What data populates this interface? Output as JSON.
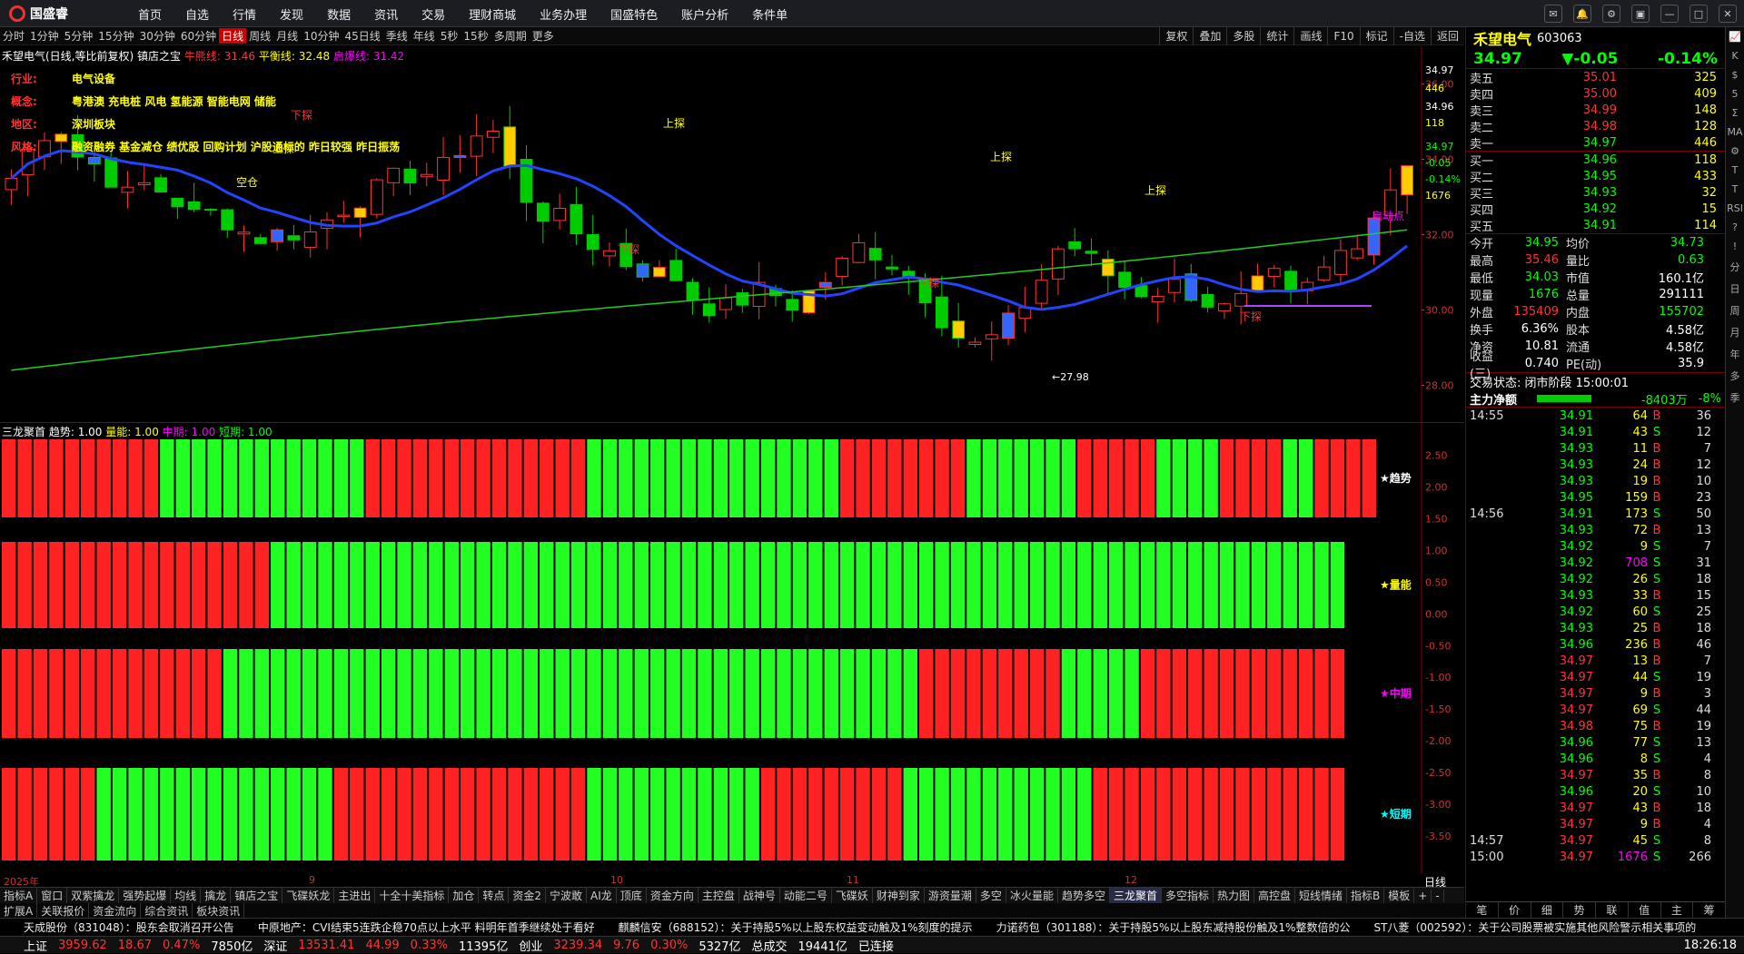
{
  "app": {
    "logo": "国盛睿",
    "menu": [
      "首页",
      "自选",
      "行情",
      "发现",
      "数据",
      "资讯",
      "交易",
      "理财商城",
      "业务办理",
      "国盛特色",
      "账户分析",
      "条件单"
    ]
  },
  "periods": [
    "分时",
    "1分钟",
    "5分钟",
    "15分钟",
    "30分钟",
    "60分钟",
    "日线",
    "周线",
    "月线",
    "10分钟",
    "45日线",
    "季线",
    "年线",
    "5秒",
    "15秒",
    "多周期",
    "更多"
  ],
  "active_period": "日线",
  "rtools": [
    "复权",
    "叠加",
    "多股",
    "统计",
    "画线",
    "F10",
    "标记",
    "-自选",
    "返回"
  ],
  "chart_title": {
    "name": "禾望电气(日线,等比前复权)",
    "tool": "镇店之宝",
    "l1": "牛熊线: 31.46",
    "l2": "平衡线: 32.48",
    "l3": "启爆线: 31.42"
  },
  "info_lines": {
    "industry_k": "行业:",
    "industry_v": "电气设备",
    "concept_k": "概念:",
    "concept_v": "粤港澳 充电桩 风电 氢能源 智能电网 储能",
    "region_k": "地区:",
    "region_v": "深圳板块",
    "style_k": "风格:",
    "style_v": "融资融券 基金减仓 绩优股 回购计划 沪股通标的 昨日较强 昨日振荡"
  },
  "chart_data": {
    "type": "candlestick",
    "ylim": [
      27,
      37
    ],
    "y_ticks": [
      "36.00",
      "34.00",
      "32.00",
      "30.00",
      "28.00"
    ],
    "right_labels": [
      "34.97",
      "446",
      "34.96",
      "118",
      "34.97",
      "-0.05",
      "-0.14%",
      "1676"
    ],
    "x_labels": [
      "2025年",
      "9",
      "10",
      "11",
      "12"
    ],
    "low_label": "←27.98",
    "annotations": [
      "下探",
      "上探",
      "空仓",
      "启动点"
    ]
  },
  "ind": {
    "name": "三龙聚首",
    "l1": "趋势: 1.00",
    "l2": "量能: 1.00",
    "l3": "中期: 1.00",
    "l4": "短期: 1.00",
    "y_ticks": [
      "2.50",
      "2.00",
      "1.50",
      "1.00",
      "0.50",
      "0.00",
      "-0.50",
      "-1.00",
      "-1.50",
      "-2.00",
      "-2.50",
      "-3.00",
      "-3.50"
    ],
    "bands": [
      "★趋势",
      "★量能",
      "★中期",
      "★短期"
    ]
  },
  "tabs": [
    "指标A",
    "窗口",
    "双紫擒龙",
    "强势起爆",
    "均线",
    "擒龙",
    "镇店之宝",
    "飞碟妖龙",
    "主进出",
    "十全十美指标",
    "加仓",
    "转点",
    "资金2",
    "宁波敢",
    "AI龙",
    "顶底",
    "资金方向",
    "主控盘",
    "战神号",
    "动能二号",
    "飞碟妖",
    "财神到家",
    "游资量潮",
    "多空",
    "冰火量能",
    "趋势多空",
    "三龙聚首",
    "多空指标",
    "热力图",
    "高控盘",
    "短线情绪",
    "指标B",
    "模板",
    "+",
    "-"
  ],
  "tabs2": [
    "扩展A",
    "关联报价",
    "资金流向",
    "综合资讯",
    "板块资讯"
  ],
  "ticker": [
    "天成股份（831048）：股东会取消召开公告",
    "中原地产：CVI结束5连跌企稳70点以上水平 料明年首季继续处于看好",
    "麒麟信安（688152）：关于持股5%以上股东权益变动触及1%刻度的提示",
    "力诺药包（301188）：关于持股5%以上股东减持股份触及1%整数倍的公",
    "ST八菱（002592）：关于公司股票被实施其他风险警示相关事项的"
  ],
  "status": {
    "sh_l": "上证",
    "sh": "3959.62",
    "sh_c": "18.67",
    "sh_p": "0.47%",
    "sh_v": "7850亿",
    "sz_l": "深证",
    "sz": "13531.41",
    "sz_c": "44.99",
    "sz_p": "0.33%",
    "sz_v": "11395亿",
    "cy_l": "创业",
    "cy": "3239.34",
    "cy_c": "9.76",
    "cy_p": "0.30%",
    "cy_v": "5327亿",
    "tot_l": "总成交",
    "tot": "19441亿",
    "conn": "已连接",
    "time": "18:26:18"
  },
  "quote": {
    "name": "禾望电气",
    "code": "603063",
    "price": "34.97",
    "chg": "▼-0.05",
    "pct": "-0.14%",
    "asks": [
      [
        "卖五",
        "35.01",
        "325"
      ],
      [
        "卖四",
        "35.00",
        "409"
      ],
      [
        "卖三",
        "34.99",
        "148"
      ],
      [
        "卖二",
        "34.98",
        "128"
      ],
      [
        "卖一",
        "34.97",
        "446"
      ]
    ],
    "bids": [
      [
        "买一",
        "34.96",
        "118"
      ],
      [
        "买二",
        "34.95",
        "433"
      ],
      [
        "买三",
        "34.93",
        "32"
      ],
      [
        "买四",
        "34.92",
        "15"
      ],
      [
        "买五",
        "34.91",
        "114"
      ]
    ],
    "stats": [
      [
        "今开",
        "34.95",
        "均价",
        "34.73"
      ],
      [
        "最高",
        "35.46",
        "量比",
        "0.63"
      ],
      [
        "最低",
        "34.03",
        "市值",
        "160.1亿"
      ],
      [
        "现量",
        "1676",
        "总量",
        "291111"
      ],
      [
        "外盘",
        "135409",
        "内盘",
        "155702"
      ],
      [
        "换手",
        "6.36%",
        "股本",
        "4.58亿"
      ],
      [
        "净资",
        "10.81",
        "流通",
        "4.58亿"
      ],
      [
        "收益(三)",
        "0.740",
        "PE(动)",
        "35.9"
      ]
    ],
    "trade_state": "交易状态: 闭市阶段 15:00:01",
    "flow_l": "主力净额",
    "flow": "-8403万",
    "flow_p": "-8%",
    "ticks": [
      [
        "14:55",
        "34.91",
        "64",
        "B",
        "36"
      ],
      [
        "",
        "34.91",
        "43",
        "S",
        "12"
      ],
      [
        "",
        "34.93",
        "11",
        "B",
        "7"
      ],
      [
        "",
        "34.93",
        "24",
        "B",
        "12"
      ],
      [
        "",
        "34.93",
        "19",
        "B",
        "10"
      ],
      [
        "",
        "34.95",
        "159",
        "B",
        "23"
      ],
      [
        "14:56",
        "34.91",
        "173",
        "S",
        "50"
      ],
      [
        "",
        "34.93",
        "72",
        "B",
        "13"
      ],
      [
        "",
        "34.92",
        "9",
        "S",
        "7"
      ],
      [
        "",
        "34.92",
        "708",
        "S",
        "31"
      ],
      [
        "",
        "34.92",
        "26",
        "S",
        "18"
      ],
      [
        "",
        "34.93",
        "33",
        "B",
        "15"
      ],
      [
        "",
        "34.92",
        "60",
        "S",
        "25"
      ],
      [
        "",
        "34.93",
        "25",
        "B",
        "18"
      ],
      [
        "",
        "34.96",
        "236",
        "B",
        "46"
      ],
      [
        "",
        "34.97",
        "13",
        "B",
        "7"
      ],
      [
        "",
        "34.97",
        "44",
        "S",
        "19"
      ],
      [
        "",
        "34.97",
        "9",
        "B",
        "3"
      ],
      [
        "",
        "34.97",
        "69",
        "S",
        "44"
      ],
      [
        "",
        "34.98",
        "75",
        "B",
        "19"
      ],
      [
        "",
        "34.96",
        "77",
        "S",
        "13"
      ],
      [
        "",
        "34.96",
        "8",
        "S",
        "4"
      ],
      [
        "",
        "34.97",
        "35",
        "B",
        "8"
      ],
      [
        "",
        "34.96",
        "20",
        "S",
        "10"
      ],
      [
        "",
        "34.97",
        "43",
        "B",
        "18"
      ],
      [
        "",
        "34.97",
        "9",
        "B",
        "4"
      ],
      [
        "14:57",
        "34.97",
        "45",
        "S",
        "8"
      ],
      [
        "15:00",
        "34.97",
        "1676",
        "S",
        "266"
      ]
    ],
    "rbot": [
      "笔",
      "价",
      "细",
      "势",
      "联",
      "值",
      "主",
      "筹"
    ]
  },
  "rside": [
    "📈",
    "K",
    "$",
    "5",
    "Σ",
    "MA",
    "⚙",
    "T",
    "T",
    "RSI",
    "?",
    "!",
    "分",
    "日",
    "周",
    "月",
    "年",
    "多",
    "季"
  ],
  "colors": {
    "up": "#ff3333",
    "down": "#00ff00"
  }
}
